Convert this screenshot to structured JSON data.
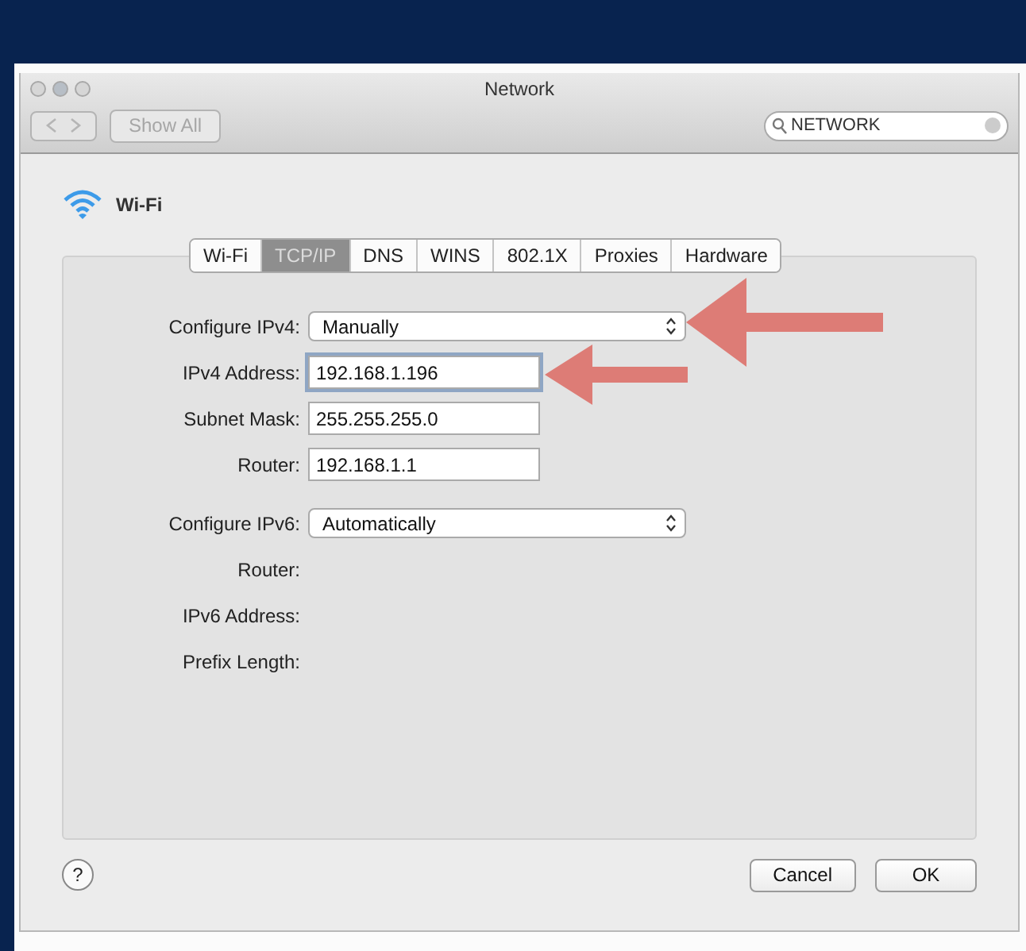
{
  "window": {
    "title": "Network"
  },
  "toolbar": {
    "show_all": "Show All",
    "search": {
      "value": "NETWORK"
    }
  },
  "service": {
    "name": "Wi-Fi"
  },
  "tabs": [
    {
      "label": "Wi-Fi",
      "selected": false
    },
    {
      "label": "TCP/IP",
      "selected": true
    },
    {
      "label": "DNS",
      "selected": false
    },
    {
      "label": "WINS",
      "selected": false
    },
    {
      "label": "802.1X",
      "selected": false
    },
    {
      "label": "Proxies",
      "selected": false
    },
    {
      "label": "Hardware",
      "selected": false
    }
  ],
  "form": [
    {
      "kind": "popup",
      "label": "Configure IPv4:",
      "value": "Manually"
    },
    {
      "kind": "field",
      "label": "IPv4 Address:",
      "value": "192.168.1.196",
      "focused": true
    },
    {
      "kind": "field",
      "label": "Subnet Mask:",
      "value": "255.255.255.0",
      "focused": false
    },
    {
      "kind": "field",
      "label": "Router:",
      "value": "192.168.1.1",
      "focused": false
    },
    {
      "kind": "popup",
      "label": "Configure IPv6:",
      "value": "Automatically"
    },
    {
      "kind": "empty",
      "label": "Router:"
    },
    {
      "kind": "empty",
      "label": "IPv6 Address:"
    },
    {
      "kind": "empty",
      "label": "Prefix Length:"
    }
  ],
  "help": {
    "label": "?"
  },
  "buttons": [
    "Cancel",
    "OK"
  ]
}
